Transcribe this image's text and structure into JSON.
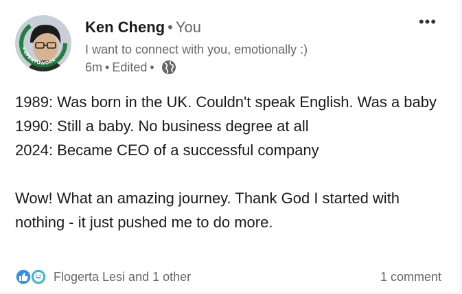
{
  "post": {
    "author": {
      "name": "Ken Cheng",
      "connection": "You",
      "headline": "I want to connect with you, emotionally :)",
      "avatar_badge": "#OPENTOWORK"
    },
    "meta": {
      "time": "6m",
      "edited": "Edited",
      "visibility_icon": "globe-icon"
    },
    "more_label": "•••",
    "body": [
      "1989: Was born in the UK. Couldn't speak English. Was a baby",
      "1990: Still a baby. No business degree at all",
      "2024: Became CEO of a successful company",
      "",
      "Wow! What an amazing journey. Thank God I started with nothing - it just pushed me to do more."
    ],
    "social": {
      "reaction_icons": [
        "like-icon",
        "funny-icon"
      ],
      "reactions_text": "Flogerta Lesi and 1 other",
      "comments_text": "1 comment"
    }
  },
  "colors": {
    "opentowork_green": "#1b7a3a",
    "like_blue": "#378fe9",
    "funny_teal": "#44b4d6",
    "secondary_text": "#666666"
  }
}
